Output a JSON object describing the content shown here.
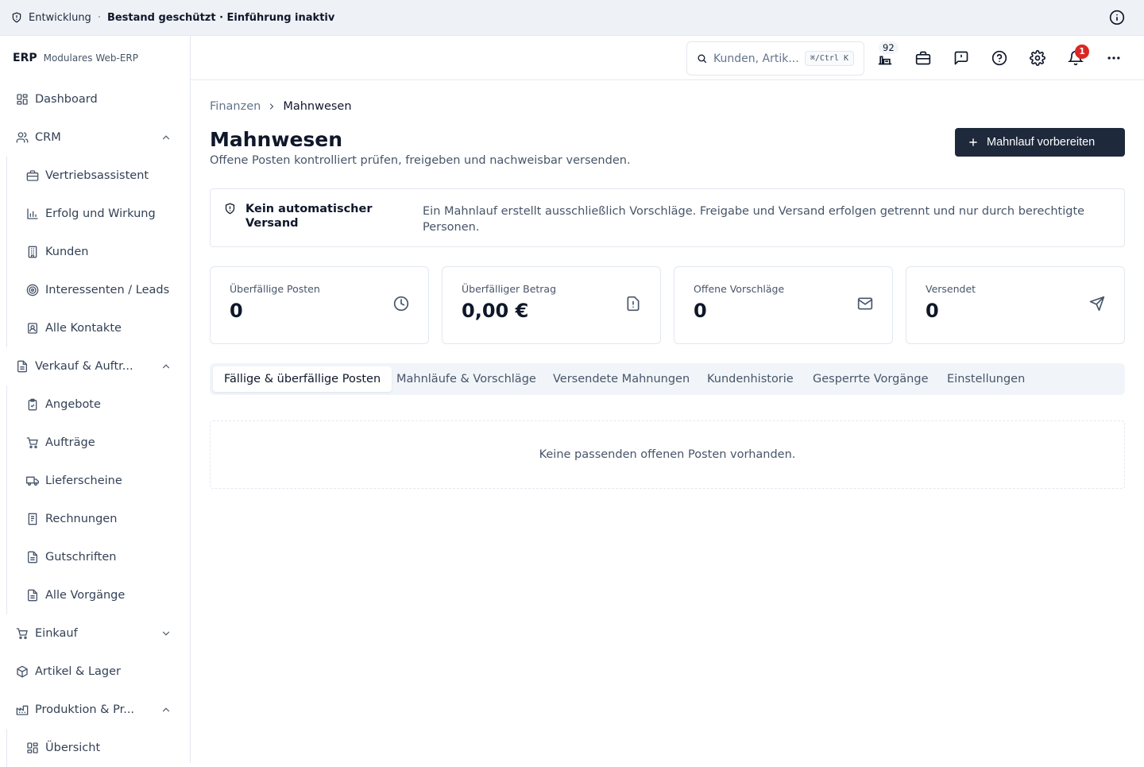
{
  "env": {
    "name": "Entwicklung",
    "separator": "·",
    "status": "Bestand geschützt · Einführung inaktiv",
    "icon": "shield-icon"
  },
  "brand": {
    "logo": "ERP",
    "tagline": "Modulares Web-ERP"
  },
  "sidebar": {
    "dashboard": "Dashboard",
    "crm": {
      "label": "CRM",
      "items": [
        "Vertriebsassistent",
        "Erfolg und Wirkung",
        "Kunden",
        "Interessenten / Leads",
        "Alle Kontakte"
      ]
    },
    "sales": {
      "label": "Verkauf & Auftr...",
      "items": [
        "Angebote",
        "Aufträge",
        "Lieferscheine",
        "Rechnungen",
        "Gutschriften",
        "Alle Vorgänge"
      ]
    },
    "purchase": "Einkauf",
    "inventory": "Artikel & Lager",
    "production": {
      "label": "Produktion & Pr...",
      "items": [
        "Übersicht"
      ]
    }
  },
  "topbar": {
    "search_placeholder": "Kunden, Artik...",
    "search_shortcut": "⌘/Ctrl K",
    "inbox_count": "92",
    "notification_count": "1"
  },
  "breadcrumb": {
    "parent": "Finanzen",
    "current": "Mahnwesen"
  },
  "page": {
    "title": "Mahnwesen",
    "subtitle": "Offene Posten kontrolliert prüfen, freigeben und nachweisbar versenden.",
    "primary_action": "Mahnlauf vorbereiten"
  },
  "notice": {
    "title": "Kein automatischer Versand",
    "text": "Ein Mahnlauf erstellt ausschließlich Vorschläge. Freigabe und Versand erfolgen getrennt und nur durch berechtigte Personen."
  },
  "kpis": [
    {
      "label": "Überfällige Posten",
      "value": "0",
      "icon": "clock-icon"
    },
    {
      "label": "Überfälliger Betrag",
      "value": "0,00 €",
      "icon": "document-alert-icon"
    },
    {
      "label": "Offene Vorschläge",
      "value": "0",
      "icon": "mail-icon"
    },
    {
      "label": "Versendet",
      "value": "0",
      "icon": "send-icon"
    }
  ],
  "tabs": [
    "Fällige & überfällige Posten",
    "Mahnläufe & Vorschläge",
    "Versendete Mahnungen",
    "Kundenhistorie",
    "Gesperrte Vorgänge",
    "Einstellungen"
  ],
  "active_tab": "Fällige & überfällige Posten",
  "empty_state": "Keine passenden offenen Posten vorhanden.",
  "colors": {
    "accent": "#1e293b",
    "badge": "#dc2626",
    "env_bar": "#eef2f7",
    "tab_bar": "#f1f5f9"
  }
}
